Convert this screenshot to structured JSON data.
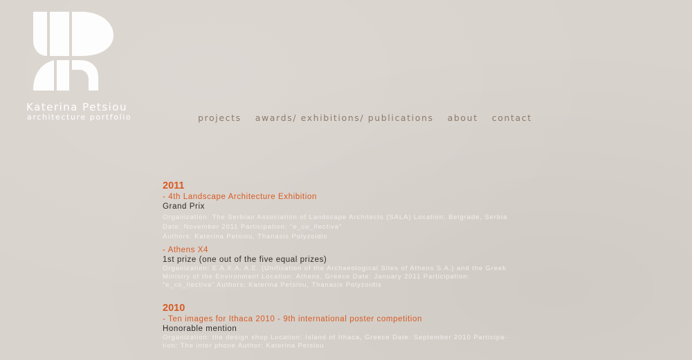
{
  "brand": {
    "name": "Katerina Petsiou",
    "subtitle": "architecture portfolio",
    "logo_icon": "kp-monogram-icon",
    "logo_color": "#ffffff"
  },
  "nav": {
    "items": [
      {
        "label": "projects"
      },
      {
        "label": "awards/ exhibitions/ publications"
      },
      {
        "label": "about"
      },
      {
        "label": "contact"
      }
    ],
    "color": "#8b7b6b"
  },
  "content": {
    "accent_color": "#d65a22",
    "years": [
      {
        "year": "2011",
        "entries": [
          {
            "title": "- 4th Landscape Architecture Exhibition",
            "award": "Grand Prix",
            "details": [
              "Organization: The Serbian Association of Landscape Architects (SALA)  Location: Belgrade, Serbia",
              "Date: November 2011 Participation: \"e_co_llectiva\"",
              "Authors: Katerina Petsiou, Thanasis Polyzoidis"
            ]
          },
          {
            "title": "- Athens X4",
            "award": "1st prize (one out of the five equal prizes)",
            "details": [
              "Organization: E.A.X.A. A.E. (Unification of the Archaeological Sites of Athens S.A.) and the Greek",
              "Ministry of the Environment   Location: Athens, Greece  Date: January 2011 Participation:",
              "\"e_co_llectiva\"  Authors: Katerina Petsiou, Thanasis Polyzoidis"
            ]
          }
        ]
      },
      {
        "year": "2010",
        "entries": [
          {
            "title": "- Ten images for Ithaca 2010 - 9th international poster competition",
            "award": "Honorable mention",
            "details": [
              "Organization: the design shop  Location: Island of Ithaca, Greece  Date: September 2010  Participa-",
              "tion: The inter phone  Author: Katerina Petsiou"
            ]
          }
        ]
      }
    ]
  }
}
